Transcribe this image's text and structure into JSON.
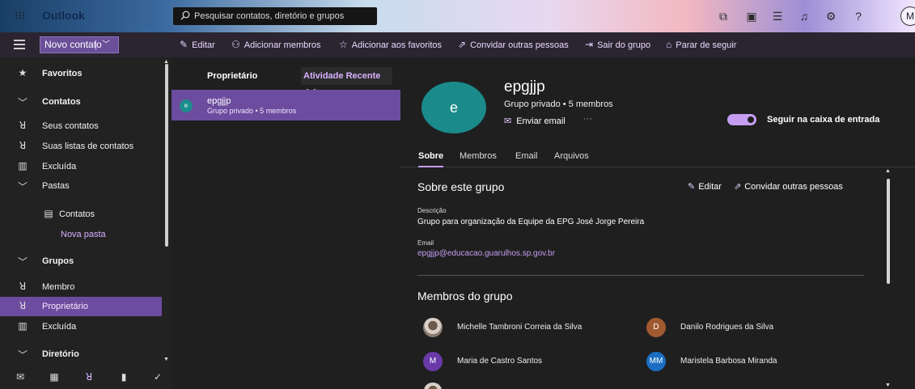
{
  "app": {
    "name": "Outlook",
    "avatar_initial": "M"
  },
  "search": {
    "placeholder": "Pesquisar contatos, diretório e grupos"
  },
  "topbar_icons": [
    "meet-now-icon",
    "office-apps-icon",
    "my-day-icon",
    "notifications-icon",
    "settings-icon",
    "help-icon"
  ],
  "commandbar": {
    "new_contact": "Novo contato",
    "actions": [
      {
        "label": "Editar",
        "icon": "pencil-icon"
      },
      {
        "label": "Adicionar membros",
        "icon": "person-add-icon"
      },
      {
        "label": "Adicionar aos favoritos",
        "icon": "star-add-icon"
      },
      {
        "label": "Convidar outras pessoas",
        "icon": "share-icon"
      },
      {
        "label": "Sair do grupo",
        "icon": "sign-out-icon"
      },
      {
        "label": "Parar de seguir",
        "icon": "unfollow-icon"
      }
    ]
  },
  "nav": {
    "favoritos": "Favoritos",
    "contatos": "Contatos",
    "seus_contatos": "Seus contatos",
    "suas_listas": "Suas listas de contatos",
    "excluida": "Excluída",
    "pastas": "Pastas",
    "contatos_folder": "Contatos",
    "nova_pasta": "Nova pasta",
    "grupos": "Grupos",
    "membro": "Membro",
    "proprietario": "Proprietário",
    "excluida2": "Excluída",
    "diretorio": "Diretório"
  },
  "bottom_nav": [
    "mail-icon",
    "calendar-icon",
    "people-icon",
    "attachment-icon",
    "todo-icon"
  ],
  "list": {
    "title": "Proprietário",
    "sort": "Atividade Recente",
    "items": [
      {
        "initial": "e",
        "name": "epgjjp",
        "sub": "Grupo privado • 5 membros"
      }
    ]
  },
  "detail": {
    "initial": "e",
    "name": "epgjjp",
    "sub": "Grupo privado • 5 membros",
    "send_email": "Enviar email",
    "more": "···",
    "follow_label": "Seguir na caixa de entrada",
    "tabs": [
      "Sobre",
      "Membros",
      "Email",
      "Arquivos"
    ],
    "about_title": "Sobre este grupo",
    "edit": "Editar",
    "invite": "Convidar outras pessoas",
    "desc_label": "Descrição",
    "desc_value": "Grupo para organização da Equipe da EPG José Jorge Pereira",
    "email_label": "Email",
    "email_value": "epgjjp@educacao.guarulhos.sp.gov.br",
    "members_title": "Membros do grupo",
    "members": [
      {
        "initials": "",
        "name": "Michelle Tambroni Correia da Silva",
        "color": "photo"
      },
      {
        "initials": "D",
        "name": "Danilo Rodrigues da Silva",
        "color": "#a05a30"
      },
      {
        "initials": "M",
        "name": "Maria de Castro Santos",
        "color": "#6a3aa8"
      },
      {
        "initials": "MM",
        "name": "Maristela Barbosa Miranda",
        "color": "#1a6fc4"
      }
    ]
  }
}
